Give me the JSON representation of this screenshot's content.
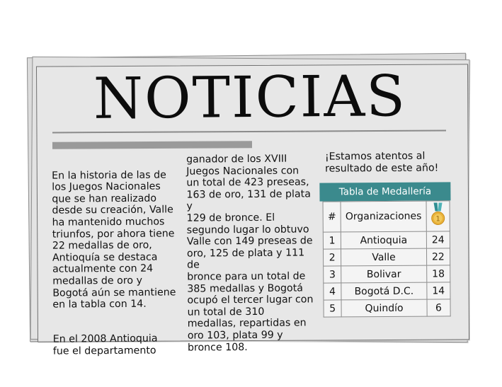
{
  "masthead": "NOTICIAS",
  "column_1": {
    "paragraph_1": "En la historia de las de\nlos Juegos Nacionales\nque se han realizado\ndesde su creación, Valle\nha mantenido muchos\ntriunfos, por ahora tiene\n22 medallas de oro,\nAntioquía se destaca\nactualmente con 24\nmedallas de oro y\nBogotá aún se mantiene\nen la tabla con 14.",
    "paragraph_2": "En el 2008 Antioquia\nfue el departamento"
  },
  "column_2": {
    "paragraph": "ganador de los XVIII\nJuegos Nacionales con\nun total de 423 preseas,\n163 de oro, 131 de plata y\n129 de bronce. El\nsegundo lugar lo obtuvo\nValle con 149 preseas de\noro, 125 de plata y 111 de\nbronce para un total de\n385 medallas y Bogotá\nocupó el tercer lugar con\nun total de 310\nmedallas, repartidas en\noro 103, plata 99 y\nbronce 108."
  },
  "note": "¡Estamos atentos al\nresultado de este año!",
  "medal_table": {
    "title": "Tabla de Medallería",
    "header": {
      "num": "#",
      "org": "Organizaciones",
      "medal_icon": "gold-medal-icon",
      "medal_number": "1"
    },
    "rows": [
      {
        "num": "1",
        "org": "Antioquia",
        "value": "24"
      },
      {
        "num": "2",
        "org": "Valle",
        "value": "22"
      },
      {
        "num": "3",
        "org": "Bolivar",
        "value": "18"
      },
      {
        "num": "4",
        "org": "Bogotá D.C.",
        "value": "14"
      },
      {
        "num": "5",
        "org": "Quindío",
        "value": "6"
      }
    ],
    "colors": {
      "header_bg": "#3b8a8d",
      "medal_gold": "#e9b23a",
      "ribbon": "#3a9ea3"
    }
  }
}
